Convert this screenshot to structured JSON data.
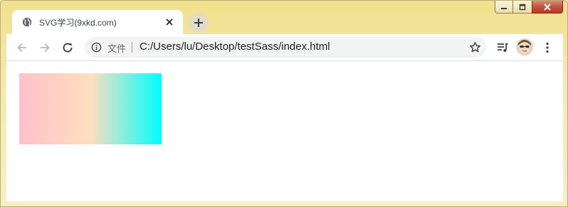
{
  "window": {
    "controls": {
      "minimize_icon": "minimize-icon",
      "maximize_icon": "maximize-icon",
      "close_icon": "close-icon",
      "close_color": "#c24e38"
    }
  },
  "tab": {
    "title": "SVG学习(9xkd.com)",
    "favicon": "globe-icon",
    "close_icon": "close-icon"
  },
  "new_tab": {
    "icon": "plus-icon"
  },
  "toolbar": {
    "back_icon": "arrow-left-icon",
    "forward_icon": "arrow-right-icon",
    "reload_icon": "reload-icon",
    "omnibox": {
      "info_icon": "info-icon",
      "label": "文件",
      "url": "C:/Users/lu/Desktop/testSass/index.html",
      "star_icon": "star-icon"
    },
    "media_icon": "media-playlist-icon",
    "profile_icon": "avatar",
    "menu_icon": "more-vert-icon"
  },
  "content": {
    "gradient_rect": {
      "stops": [
        {
          "offset": "0%",
          "color": "#ffc0cb"
        },
        {
          "offset": "50%",
          "color": "#ffdfbf"
        },
        {
          "offset": "100%",
          "color": "#00ffff"
        }
      ]
    }
  }
}
